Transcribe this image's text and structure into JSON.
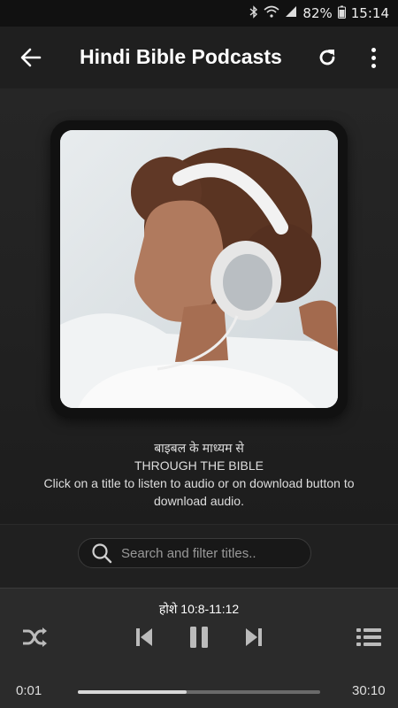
{
  "status_bar": {
    "battery": "82%",
    "time": "15:14",
    "icons": [
      "bluetooth-icon",
      "wifi-icon",
      "signal-icon",
      "battery-icon"
    ]
  },
  "app_bar": {
    "title": "Hindi Bible Podcasts",
    "back_icon": "arrow-left-icon",
    "refresh_icon": "refresh-icon",
    "menu_icon": "more-vert-icon"
  },
  "description": {
    "line1": "बाइबल के माध्यम से",
    "line2": "THROUGH THE BIBLE",
    "line3": "Click on a title to listen to audio or on download button to",
    "line4": "download audio."
  },
  "search": {
    "placeholder": "Search and filter titles.."
  },
  "player": {
    "track_title": "होशे 10:8-11:12",
    "elapsed": "0:01",
    "duration": "30:10",
    "progress": 0.45
  }
}
